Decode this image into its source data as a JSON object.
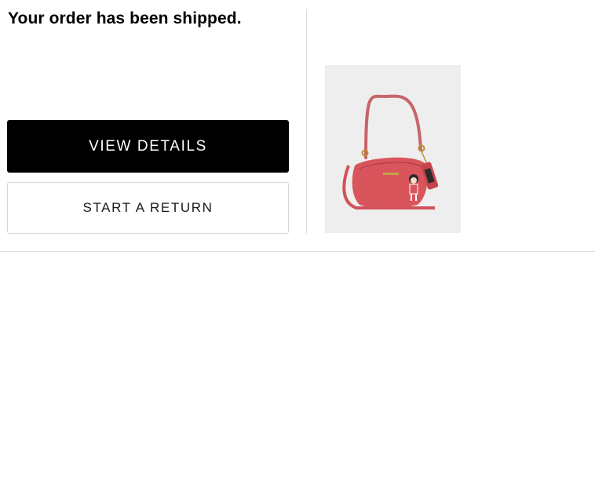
{
  "email": {
    "headline": "Your order has been shipped.",
    "primary_button_label": "VIEW DETAILS",
    "secondary_button_label": "START A RETURN"
  },
  "product": {
    "image": "pink-shoulder-bag-product-photo",
    "bag_color": "#d9555c",
    "background_color": "#efeeee"
  },
  "colors": {
    "primary_button_bg": "#000000",
    "primary_button_text": "#ffffff",
    "divider": "#dedede"
  }
}
